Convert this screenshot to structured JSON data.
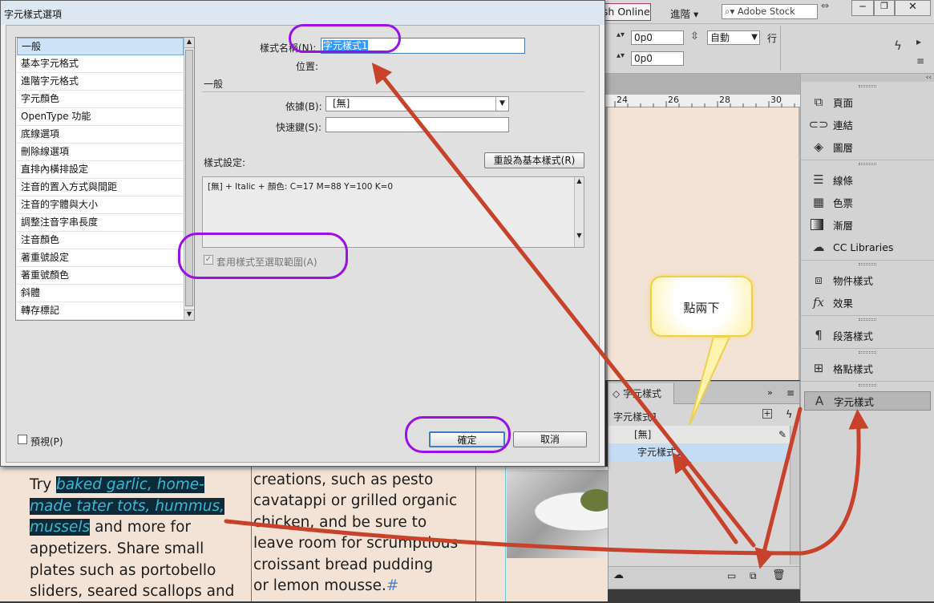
{
  "dialog": {
    "title": "字元樣式選項",
    "categories": [
      "一般",
      "基本字元格式",
      "進階字元格式",
      "字元顏色",
      "OpenType 功能",
      "底線選項",
      "刪除線選項",
      "直排內橫排設定",
      "注音的置入方式與間距",
      "注音的字體與大小",
      "調整注音字串長度",
      "注音顏色",
      "著重號設定",
      "著重號顏色",
      "斜體",
      "轉存標記"
    ],
    "style_name_label": "樣式名稱(N):",
    "style_name_value": "字元樣式1",
    "location_label": "位置:",
    "section_title": "一般",
    "based_on_label": "依據(B):",
    "based_on_value": "[無]",
    "shortcut_label": "快速鍵(S):",
    "shortcut_value": "",
    "style_settings_label": "樣式設定:",
    "reset_button": "重設為基本樣式(R)",
    "settings_text": "[無] + Italic + 顏色: C=17 M=88 Y=100 K=0",
    "apply_checkbox": "套用樣式至選取範圍(A)",
    "preview_checkbox": "預視(P)",
    "ok_button": "確定",
    "cancel_button": "取消"
  },
  "topbar": {
    "publish_online": "sh Online",
    "workspace": "進階",
    "search_placeholder": "Adobe Stock"
  },
  "controls": {
    "field1": "0p0",
    "field2": "0p0",
    "leading": "自動",
    "row_label": "行"
  },
  "ruler_ticks": [
    "24",
    "26",
    "28",
    "30"
  ],
  "right_panel": {
    "items": [
      {
        "label": "頁面",
        "icon": "pages-icon"
      },
      {
        "label": "連結",
        "icon": "links-icon"
      },
      {
        "label": "圖層",
        "icon": "layers-icon"
      },
      {
        "label": "線條",
        "icon": "stroke-icon"
      },
      {
        "label": "色票",
        "icon": "swatches-icon"
      },
      {
        "label": "漸層",
        "icon": "gradient-icon"
      },
      {
        "label": "CC Libraries",
        "icon": "cc-libraries-icon"
      },
      {
        "label": "物件樣式",
        "icon": "object-styles-icon"
      },
      {
        "label": "效果",
        "icon": "effects-icon"
      },
      {
        "label": "段落樣式",
        "icon": "paragraph-styles-icon"
      },
      {
        "label": "格點樣式",
        "icon": "grid-styles-icon"
      },
      {
        "label": "字元樣式",
        "icon": "character-styles-icon"
      }
    ]
  },
  "char_panel": {
    "tab": "字元樣式",
    "current": "字元樣式1",
    "items": [
      "[無]",
      "字元樣式1"
    ]
  },
  "callout": "點兩下",
  "document": {
    "col1": {
      "prefix": "Try ",
      "hl1": "baked garlic, home-",
      "hl2": "made tater tots, hummus,",
      "hl3": "mussels",
      "after_hl3": " and more for",
      "line4": "appetizers. Share small",
      "line5": "plates such as portobello",
      "line6": "sliders, seared scallops and"
    },
    "col2": {
      "line1": "creations, such as pesto",
      "line2": "cavatappi or grilled organic",
      "line3": "chicken, and be sure to",
      "line4": "leave room for scrumptious",
      "line5": "croissant bread pudding",
      "line6": "or lemon mousse.",
      "end_mark": "#"
    }
  },
  "colors": {
    "accent_purple": "#9a10e8",
    "arrow_red": "#c8412a",
    "highlight_text": "#37b9d6",
    "selection_blue": "#3399ff",
    "page_bg": "#f3e3d6"
  }
}
